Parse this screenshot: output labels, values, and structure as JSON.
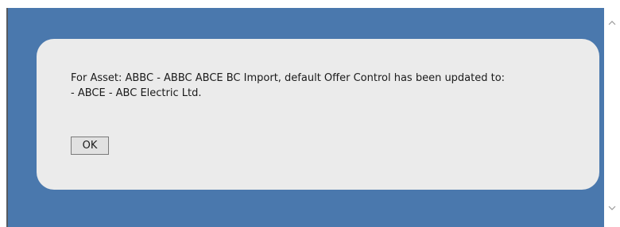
{
  "dialog": {
    "message_line1": "For Asset: ABBC - ABBC ABCE BC Import, default Offer Control has been updated to:",
    "message_line2": "- ABCE - ABC Electric Ltd.",
    "ok_label": "OK"
  },
  "colors": {
    "backdrop": "#4a78ad",
    "dialog_background": "#ebebeb",
    "button_background": "#e1e1e1"
  },
  "icons": {
    "scroll_up": "chevron-up-icon",
    "scroll_down": "chevron-down-icon"
  }
}
